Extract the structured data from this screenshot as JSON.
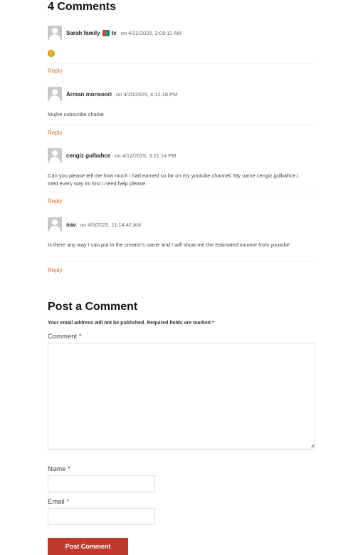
{
  "comments_heading": "4 Comments",
  "comments": [
    {
      "author": "Sarah family",
      "badge_text": "tv",
      "date": "on 4/22/2025, 2:09:11 AM",
      "body": "",
      "has_emoji": true,
      "reply": "Reply"
    },
    {
      "author": "Arman monsoori",
      "date": "on 4/20/2025, 4:12:18 PM",
      "body": "Mujhe subscribe chahie",
      "reply": "Reply"
    },
    {
      "author": "cengiz gulbahce",
      "date": "on 4/12/2025, 3:21:14 PM",
      "body": "Can you please tell me how much i had earned so far on my youtube channel. My name cengiz gulbahce.i tried every way im lost i need help please.",
      "reply": "Reply"
    },
    {
      "author": "nav",
      "date": "on 4/3/2025, 11:14:42 AM",
      "body": "Is there any way I can put in the creator's name and I will show me the estimated income from youtube",
      "reply": "Reply"
    }
  ],
  "form": {
    "heading": "Post a Comment",
    "note": "Your email address will not be published. Required fields are marked *",
    "comment_label": "Comment *",
    "name_label": "Name *",
    "email_label": "Email *",
    "submit_label": "Post Comment"
  },
  "colors": {
    "reply": "#d2691e",
    "button": "#c0392b"
  }
}
